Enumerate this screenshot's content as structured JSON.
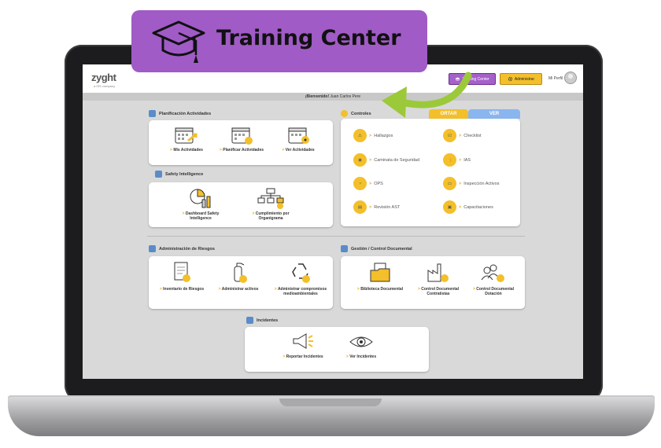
{
  "banner": {
    "title": "Training Center"
  },
  "topbar": {
    "logo": "zyght",
    "logo_sub": "a ISS company",
    "training_btn": "Training Center",
    "admin_btn": "Administrar",
    "profile": "Mi Perfil"
  },
  "welcome": {
    "prefix": "¡Bienvenido!",
    "name": "Juan Carlos Pere"
  },
  "planificacion": {
    "title": "Planificación Actividades",
    "tiles": [
      {
        "label": "Mis Actividades"
      },
      {
        "label": "Planificar Actividades"
      },
      {
        "label": "Ver Actividades"
      }
    ]
  },
  "safety": {
    "title": "Safety Intelligence",
    "tiles": [
      {
        "label": "Dashboard Safety Intelligence"
      },
      {
        "label": "Cumplimiento por Organigrama"
      }
    ]
  },
  "controles": {
    "title": "Controles",
    "tab_reportar": "ORTAR",
    "tab_ver": "VER",
    "items": [
      {
        "label": "Hallazgos"
      },
      {
        "label": "Checklist"
      },
      {
        "label": "Caminata de Seguridad"
      },
      {
        "label": "IAS"
      },
      {
        "label": "OPS"
      },
      {
        "label": "Inspección Activos"
      },
      {
        "label": "Revisión AST"
      },
      {
        "label": "Capacitaciones"
      }
    ]
  },
  "riesgos": {
    "title": "Administración de Riesgos",
    "tiles": [
      {
        "label": "Inventario de Riesgos"
      },
      {
        "label": "Administrar activos"
      },
      {
        "label": "Administrar compromisos medioambientales"
      }
    ]
  },
  "gestion": {
    "title": "Gestión / Control Documental",
    "tiles": [
      {
        "label": "Biblioteca Documental"
      },
      {
        "label": "Control Documental Contratistas"
      },
      {
        "label": "Control Documental Dotación"
      }
    ]
  },
  "incidentes": {
    "title": "Incidentes",
    "tiles": [
      {
        "label": "Reportar Incidentes"
      },
      {
        "label": "Ver Incidentes"
      }
    ]
  },
  "colors": {
    "accent": "#f3bf2a",
    "purple": "#a05bc6",
    "blue": "#8ab6f0",
    "green_arrow": "#9bc93a"
  }
}
